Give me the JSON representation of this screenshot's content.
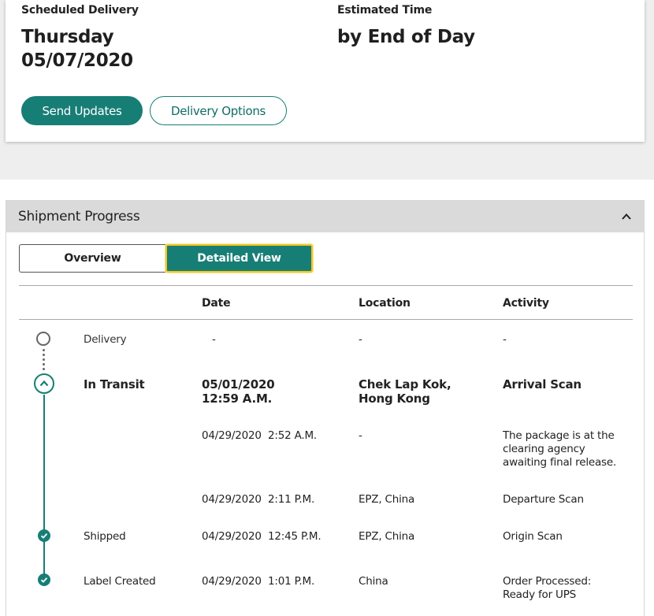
{
  "delivery": {
    "scheduled_label": "Scheduled Delivery",
    "scheduled_day": "Thursday",
    "scheduled_date": "05/07/2020",
    "estimated_label": "Estimated Time",
    "estimated_value": "by End of Day",
    "send_updates_label": "Send Updates",
    "delivery_options_label": "Delivery Options"
  },
  "progress": {
    "title": "Shipment Progress",
    "tabs": [
      {
        "label": "Overview",
        "selected": false
      },
      {
        "label": "Detailed View",
        "selected": true
      }
    ],
    "columns": {
      "date": "Date",
      "location": "Location",
      "activity": "Activity"
    },
    "rows": [
      {
        "milestone": "Delivery",
        "date": "-",
        "location": "-",
        "activity": "-",
        "status": "pending"
      },
      {
        "milestone": "In Transit",
        "date": "05/01/2020",
        "time": "12:59 A.M.",
        "location": "Chek Lap Kok,",
        "location2": "Hong Kong",
        "activity": "Arrival Scan",
        "status": "current"
      },
      {
        "milestone": "",
        "date": "04/29/2020  2:52 A.M.",
        "location": "-",
        "activity": "The package is at the",
        "activity2": "clearing agency",
        "activity3": "awaiting final release."
      },
      {
        "milestone": "",
        "date": "04/29/2020  2:11 P.M.",
        "location": "EPZ, China",
        "activity": "Departure Scan"
      },
      {
        "milestone": "Shipped",
        "date": "04/29/2020  12:45 P.M.",
        "location": "EPZ, China",
        "activity": "Origin Scan",
        "status": "done"
      },
      {
        "milestone": "Label Created",
        "date": "04/29/2020  1:01 P.M.",
        "location": "China",
        "activity": "Order Processed:",
        "activity2": "Ready for UPS",
        "status": "done"
      }
    ]
  },
  "colors": {
    "accent": "#177e76",
    "focus": "#f4c81d",
    "header_bg": "#dadada"
  },
  "icons": [
    "chevron-up-icon",
    "chevron-up-circle-icon",
    "check-circle-icon",
    "empty-circle-icon"
  ]
}
